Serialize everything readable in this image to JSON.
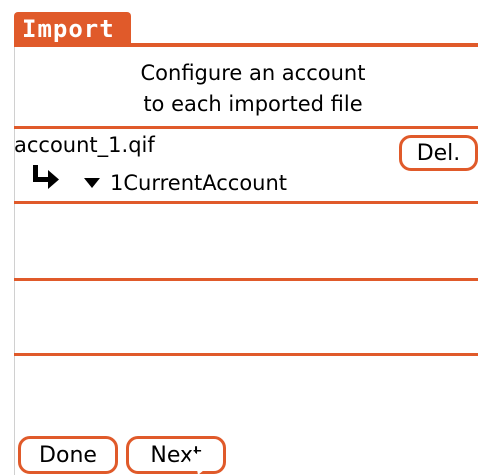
{
  "window": {
    "title": "Import"
  },
  "instructions": {
    "line1": "Configure an account",
    "line2": "to each imported file"
  },
  "files": [
    {
      "filename": "account_1.qif",
      "account": "1CurrentAccount",
      "delete_label": "Del."
    }
  ],
  "empty_rows": 3,
  "buttons": {
    "done": "Done",
    "next": "Next"
  },
  "icons": {
    "mapping_arrow": "arrow-down-right-icon",
    "dropdown": "chevron-down-icon",
    "cursor": "mouse-pointer-icon"
  },
  "colors": {
    "accent": "#e05a2a",
    "background": "#ffffff",
    "text": "#000000",
    "title_text": "#ffffff"
  }
}
